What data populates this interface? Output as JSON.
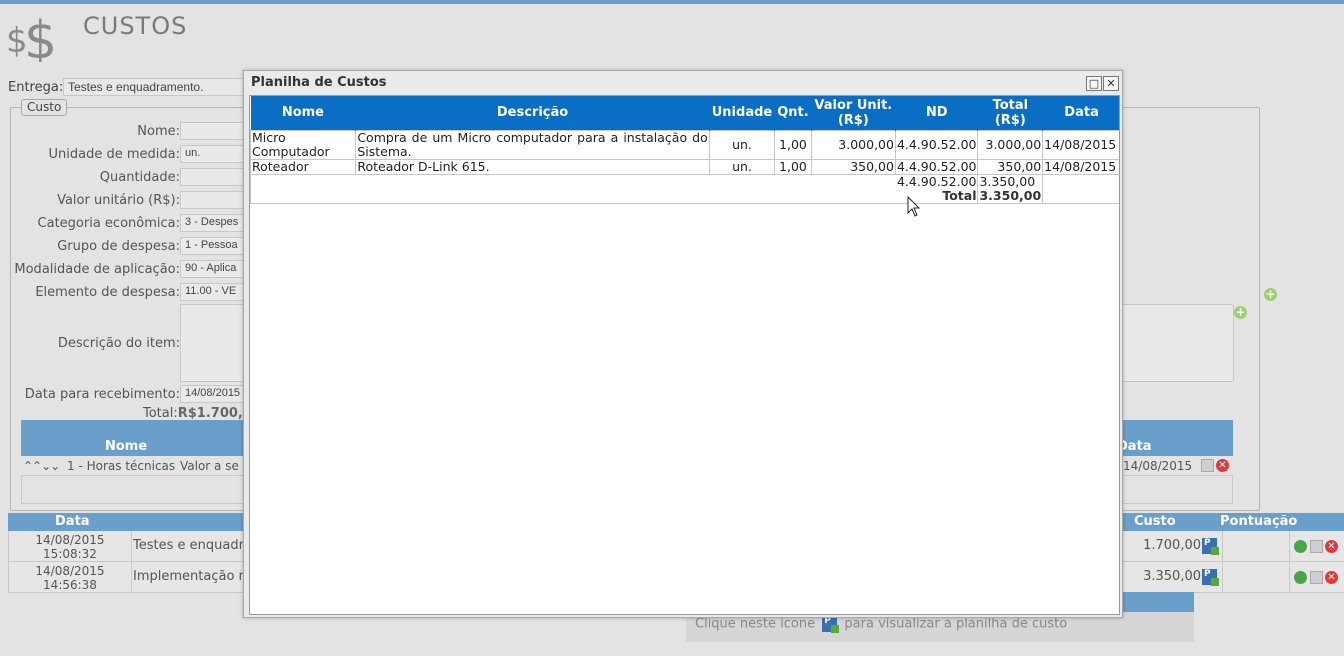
{
  "page": {
    "title": "CUSTOS",
    "entrega_label": "Entrega:",
    "entrega_value": "Testes e enquadramento.",
    "fieldset_legend": "Custo"
  },
  "form": {
    "nome_label": "Nome:",
    "nome_value": "",
    "unidade_label": "Unidade de medida:",
    "unidade_value": "un.",
    "quantidade_label": "Quantidade:",
    "quantidade_value": "",
    "valor_label": "Valor unitário (R$):",
    "valor_value": "",
    "categoria_label": "Categoria econômica:",
    "categoria_value": "3 - Despes",
    "grupo_label": "Grupo de despesa:",
    "grupo_value": "1 - Pessoa",
    "modalidade_label": "Modalidade de aplicação:",
    "modalidade_value": "90 - Aplica",
    "elemento_label": "Elemento de despesa:",
    "elemento_value": "11.00 - VE",
    "descricao_label": "Descrição do item:",
    "data_label": "Data para recebimento:",
    "data_value": "14/08/2015",
    "total_label": "Total:",
    "total_value": "R$1.700,"
  },
  "items_table": {
    "col_nome": "Nome",
    "col_data": "Data",
    "row": {
      "arrows": "⌃⌃⌄⌄",
      "nome": "1 - Horas técnicas",
      "valor": "Valor a se",
      "data": "14/08/2015"
    }
  },
  "bottom_table": {
    "col_data": "Data",
    "col_custo": "Custo",
    "col_pontuacao": "Pontuação",
    "rows": [
      {
        "date": "14/08/2015",
        "time": "15:08:32",
        "desc": "Testes e enquadr",
        "cost": "1.700,00"
      },
      {
        "date": "14/08/2015",
        "time": "14:56:38",
        "desc": "Implementação n",
        "cost": "3.350,00"
      }
    ]
  },
  "hint": {
    "before": "Clique neste ícone",
    "after": "para visualizar a planilha de custo"
  },
  "modal": {
    "title": "Planilha de Custos",
    "maximize_glyph": "□",
    "close_glyph": "✕",
    "headers": {
      "nome": "Nome",
      "descricao": "Descrição",
      "unidade": "Unidade",
      "qnt": "Qnt.",
      "valor_unit_1": "Valor Unit.",
      "valor_unit_2": "(R$)",
      "nd": "ND",
      "total": "Total (R$)",
      "data": "Data"
    },
    "rows": [
      {
        "nome_1": "Micro",
        "nome_2": "Computador",
        "desc_1": "Compra de um Micro computador para a instalação do",
        "desc_2": "Sistema.",
        "unidade": "un.",
        "qnt": "1,00",
        "valor": "3.000,00",
        "nd": "4.4.90.52.00",
        "total": "3.000,00",
        "data": "14/08/2015"
      },
      {
        "nome": "Roteador",
        "desc": "Roteador D-Link 615.",
        "unidade": "un.",
        "qnt": "1,00",
        "valor": "350,00",
        "nd": "4.4.90.52.00",
        "total": "350,00",
        "data": "14/08/2015"
      }
    ],
    "subtotal": {
      "nd": "4.4.90.52.00",
      "value": "3.350,00"
    },
    "total": {
      "label": "Total",
      "value": "3.350,00"
    }
  }
}
